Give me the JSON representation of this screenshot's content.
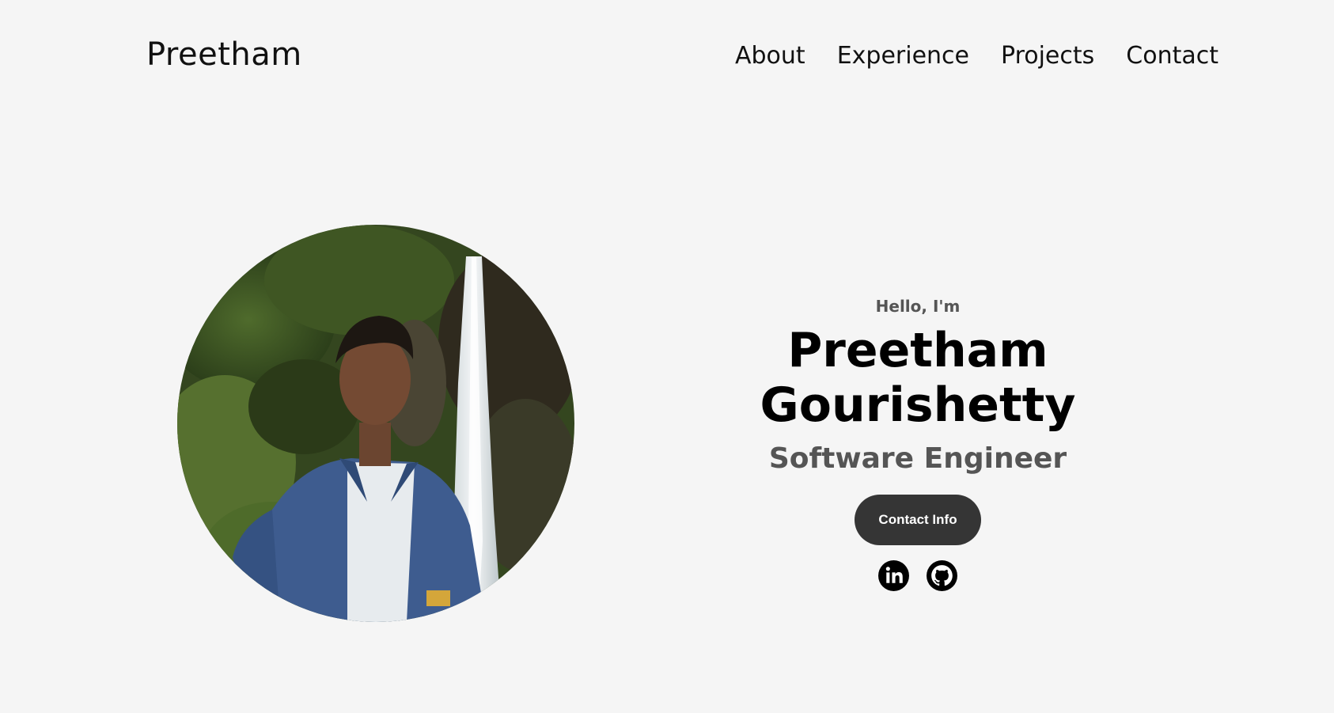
{
  "nav": {
    "logo": "Preetham",
    "links": [
      {
        "label": "About"
      },
      {
        "label": "Experience"
      },
      {
        "label": "Projects"
      },
      {
        "label": "Contact"
      }
    ]
  },
  "hero": {
    "greeting": "Hello, I'm",
    "name": "Preetham Gourishetty",
    "role": "Software Engineer",
    "button_label": "Contact Info",
    "socials": [
      {
        "icon": "linkedin-icon"
      },
      {
        "icon": "github-icon"
      }
    ]
  },
  "colors": {
    "background": "#f5f5f5",
    "button_bg": "#353535",
    "secondary_text": "#555555"
  }
}
